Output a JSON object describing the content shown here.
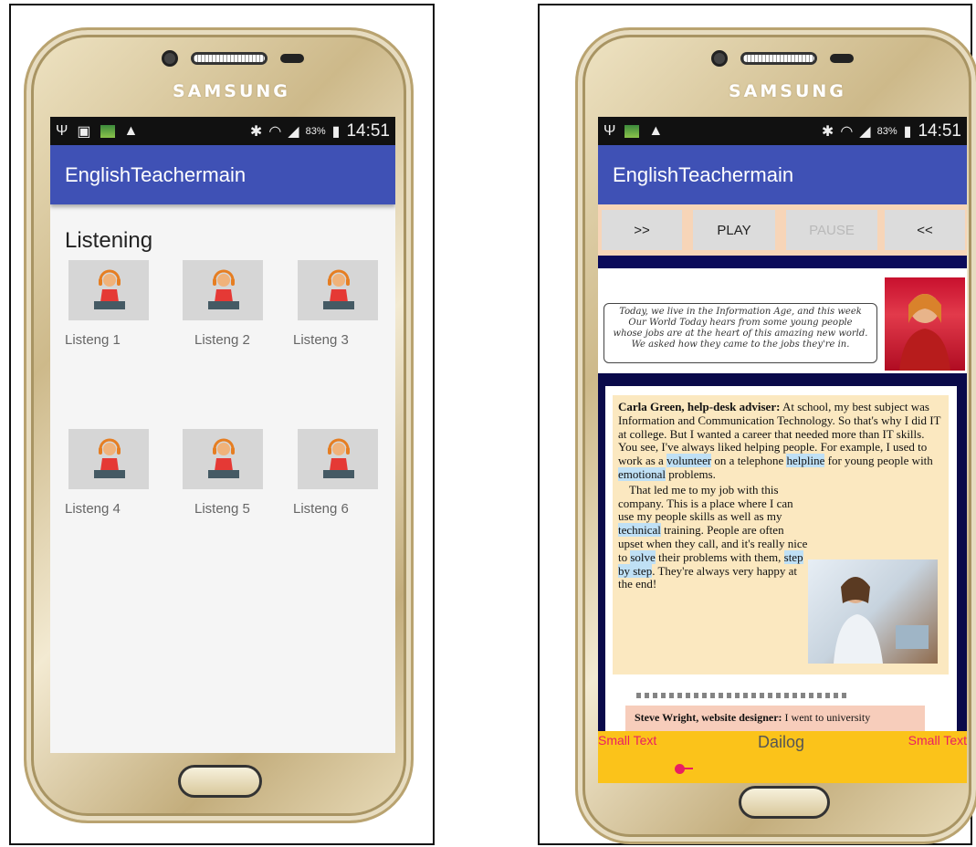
{
  "left_phone": {
    "brand": "SAMSUNG",
    "status_bar": {
      "battery": "83%",
      "time": "14:51"
    },
    "app_title": "EnglishTeachermain",
    "heading": "Listening",
    "items": [
      {
        "label": "Listeng 1"
      },
      {
        "label": "Listeng 2"
      },
      {
        "label": "Listeng 3"
      },
      {
        "label": "Listeng 4"
      },
      {
        "label": "Listeng 5"
      },
      {
        "label": "Listeng 6"
      }
    ]
  },
  "right_phone": {
    "brand": "SAMSUNG",
    "status_bar": {
      "battery": "83%",
      "time": "14:51"
    },
    "app_title": "EnglishTeachermain",
    "controls": {
      "forward": ">>",
      "play": "PLAY",
      "pause": "PAUSE",
      "back": "<<"
    },
    "intro_text": [
      "Today, we live in the Information Age, and this week",
      "Our World Today hears from some young people",
      "whose jobs are at the heart of this amazing new world.",
      "We asked how they came to the jobs they're in."
    ],
    "article": {
      "p1_name": "Carla Green, help-desk adviser:",
      "p1_a": " At school, my best subject was Information and Communication Technology. So that's why I did IT at college. But I wanted a career that needed more than IT skills. You see, I've always liked helping people. For example, I used to work as a ",
      "p1_hl1": "volunteer",
      "p1_b": " on a telephone ",
      "p1_hl2": "helpline",
      "p1_c": " for young people with ",
      "p1_hl3": "emotional",
      "p1_d": " problems.",
      "p2_a": "That led me to my job with this company. This is a place where I can use my people skills as well as my ",
      "p2_hl1": "technical",
      "p2_b": " training. People are often upset when they call, and it's really nice to ",
      "p2_hl2": "solve",
      "p2_c": " their problems with them, ",
      "p2_hl3": "step by step",
      "p2_d": ". They're always very happy at the end!",
      "steve_name": "Steve Wright, website designer:",
      "steve_text": " I went to university"
    },
    "dialog": {
      "small_left": "Small Text",
      "title": "Dailog",
      "small_right": "Small Text"
    }
  }
}
